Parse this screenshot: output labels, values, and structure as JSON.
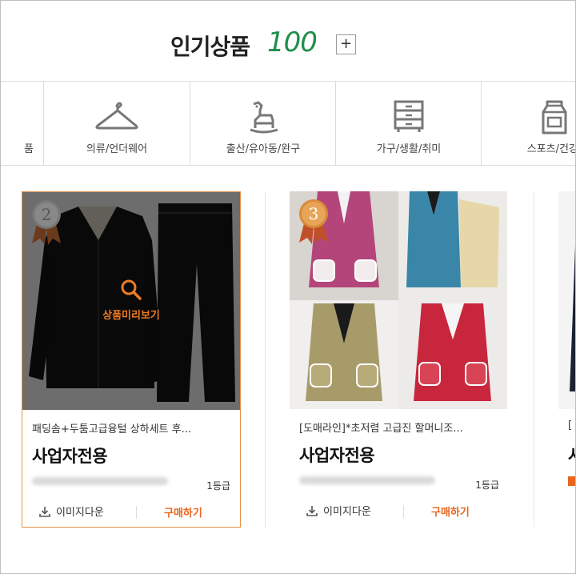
{
  "header": {
    "title": "인기상품",
    "count": "100",
    "plus_label": "+"
  },
  "categories": [
    {
      "label": "품",
      "icon": "partial-icon"
    },
    {
      "label": "의류/언더웨어",
      "icon": "hanger-icon"
    },
    {
      "label": "출산/유아동/완구",
      "icon": "rocking-horse-icon"
    },
    {
      "label": "가구/생활/취미",
      "icon": "drawer-cabinet-icon"
    },
    {
      "label": "스포츠/건강/",
      "icon": "milk-carton-icon"
    }
  ],
  "products": [
    {
      "rank": "2",
      "preview_label": "상품미리보기",
      "name": "패딩솜+두툼고급융털 상하세트 후...",
      "price": "사업자전용",
      "grade": "1등급",
      "download_label": "이미지다운",
      "buy_label": "구매하기"
    },
    {
      "rank": "3",
      "name": "[도매라인]*초저렴 고급진 할머니조...",
      "price": "사업자전용",
      "grade": "1등급",
      "download_label": "이미지다운",
      "buy_label": "구매하기"
    },
    {
      "name": "[",
      "price": "사"
    }
  ],
  "colors": {
    "accent_green": "#1f8e4a",
    "accent_orange": "#e8661f",
    "active_border": "#e59046"
  }
}
